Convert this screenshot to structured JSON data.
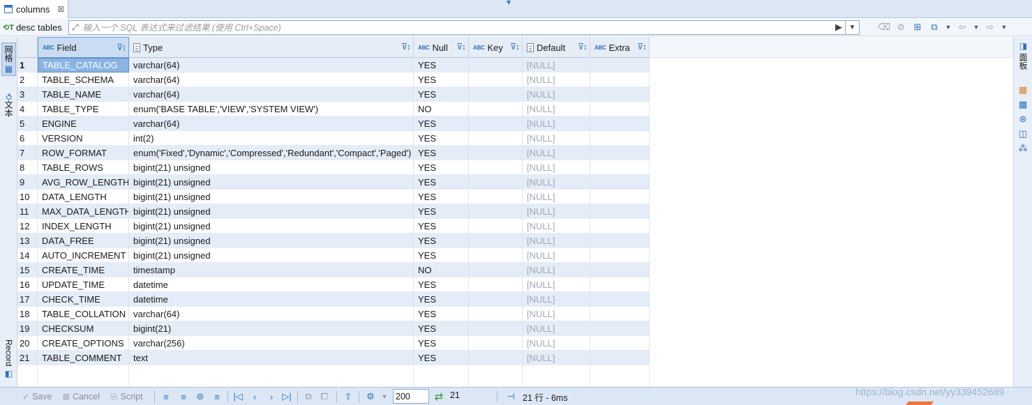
{
  "tab": {
    "title": "columns",
    "close": "⊠"
  },
  "filter": {
    "label": "desc tables",
    "placeholder": "输入一个 SQL 表达式来过滤结果 (使用 Ctrl+Space)"
  },
  "left_tabs": {
    "grid": "网格",
    "text": "文本",
    "record": "Record"
  },
  "right_tabs": {
    "panels": "面板"
  },
  "columns": [
    {
      "name": "Field",
      "icon": "abc-icon"
    },
    {
      "name": "Type",
      "icon": "doc-icon"
    },
    {
      "name": "Null",
      "icon": "abc-icon"
    },
    {
      "name": "Key",
      "icon": "abc-icon"
    },
    {
      "name": "Default",
      "icon": "doc-icon"
    },
    {
      "name": "Extra",
      "icon": "abc-icon"
    }
  ],
  "rows": [
    {
      "n": "1",
      "field": "TABLE_CATALOG",
      "type": "varchar(64)",
      "null": "YES",
      "key": "",
      "default": "[NULL]",
      "extra": ""
    },
    {
      "n": "2",
      "field": "TABLE_SCHEMA",
      "type": "varchar(64)",
      "null": "YES",
      "key": "",
      "default": "[NULL]",
      "extra": ""
    },
    {
      "n": "3",
      "field": "TABLE_NAME",
      "type": "varchar(64)",
      "null": "YES",
      "key": "",
      "default": "[NULL]",
      "extra": ""
    },
    {
      "n": "4",
      "field": "TABLE_TYPE",
      "type": "enum('BASE TABLE','VIEW','SYSTEM VIEW')",
      "null": "NO",
      "key": "",
      "default": "[NULL]",
      "extra": ""
    },
    {
      "n": "5",
      "field": "ENGINE",
      "type": "varchar(64)",
      "null": "YES",
      "key": "",
      "default": "[NULL]",
      "extra": ""
    },
    {
      "n": "6",
      "field": "VERSION",
      "type": "int(2)",
      "null": "YES",
      "key": "",
      "default": "[NULL]",
      "extra": ""
    },
    {
      "n": "7",
      "field": "ROW_FORMAT",
      "type": "enum('Fixed','Dynamic','Compressed','Redundant','Compact','Paged')",
      "null": "YES",
      "key": "",
      "default": "[NULL]",
      "extra": ""
    },
    {
      "n": "8",
      "field": "TABLE_ROWS",
      "type": "bigint(21) unsigned",
      "null": "YES",
      "key": "",
      "default": "[NULL]",
      "extra": ""
    },
    {
      "n": "9",
      "field": "AVG_ROW_LENGTH",
      "type": "bigint(21) unsigned",
      "null": "YES",
      "key": "",
      "default": "[NULL]",
      "extra": ""
    },
    {
      "n": "10",
      "field": "DATA_LENGTH",
      "type": "bigint(21) unsigned",
      "null": "YES",
      "key": "",
      "default": "[NULL]",
      "extra": ""
    },
    {
      "n": "11",
      "field": "MAX_DATA_LENGTH",
      "type": "bigint(21) unsigned",
      "null": "YES",
      "key": "",
      "default": "[NULL]",
      "extra": ""
    },
    {
      "n": "12",
      "field": "INDEX_LENGTH",
      "type": "bigint(21) unsigned",
      "null": "YES",
      "key": "",
      "default": "[NULL]",
      "extra": ""
    },
    {
      "n": "13",
      "field": "DATA_FREE",
      "type": "bigint(21) unsigned",
      "null": "YES",
      "key": "",
      "default": "[NULL]",
      "extra": ""
    },
    {
      "n": "14",
      "field": "AUTO_INCREMENT",
      "type": "bigint(21) unsigned",
      "null": "YES",
      "key": "",
      "default": "[NULL]",
      "extra": ""
    },
    {
      "n": "15",
      "field": "CREATE_TIME",
      "type": "timestamp",
      "null": "NO",
      "key": "",
      "default": "[NULL]",
      "extra": ""
    },
    {
      "n": "16",
      "field": "UPDATE_TIME",
      "type": "datetime",
      "null": "YES",
      "key": "",
      "default": "[NULL]",
      "extra": ""
    },
    {
      "n": "17",
      "field": "CHECK_TIME",
      "type": "datetime",
      "null": "YES",
      "key": "",
      "default": "[NULL]",
      "extra": ""
    },
    {
      "n": "18",
      "field": "TABLE_COLLATION",
      "type": "varchar(64)",
      "null": "YES",
      "key": "",
      "default": "[NULL]",
      "extra": ""
    },
    {
      "n": "19",
      "field": "CHECKSUM",
      "type": "bigint(21)",
      "null": "YES",
      "key": "",
      "default": "[NULL]",
      "extra": ""
    },
    {
      "n": "20",
      "field": "CREATE_OPTIONS",
      "type": "varchar(256)",
      "null": "YES",
      "key": "",
      "default": "[NULL]",
      "extra": ""
    },
    {
      "n": "21",
      "field": "TABLE_COMMENT",
      "type": "text",
      "null": "YES",
      "key": "",
      "default": "[NULL]",
      "extra": ""
    }
  ],
  "bottom": {
    "save": "Save",
    "cancel": "Cancel",
    "script": "Script",
    "fetch_size": "200",
    "row_count": "21",
    "status": "21 行 - 6ms"
  },
  "watermark": "https://blog.csdn.net/yy339452689",
  "colors": {
    "accent": "#2f6fba",
    "odd_row": "#e4ecf7",
    "selected_cell": "#8ab4e3",
    "null_text": "#a0a8b3"
  }
}
